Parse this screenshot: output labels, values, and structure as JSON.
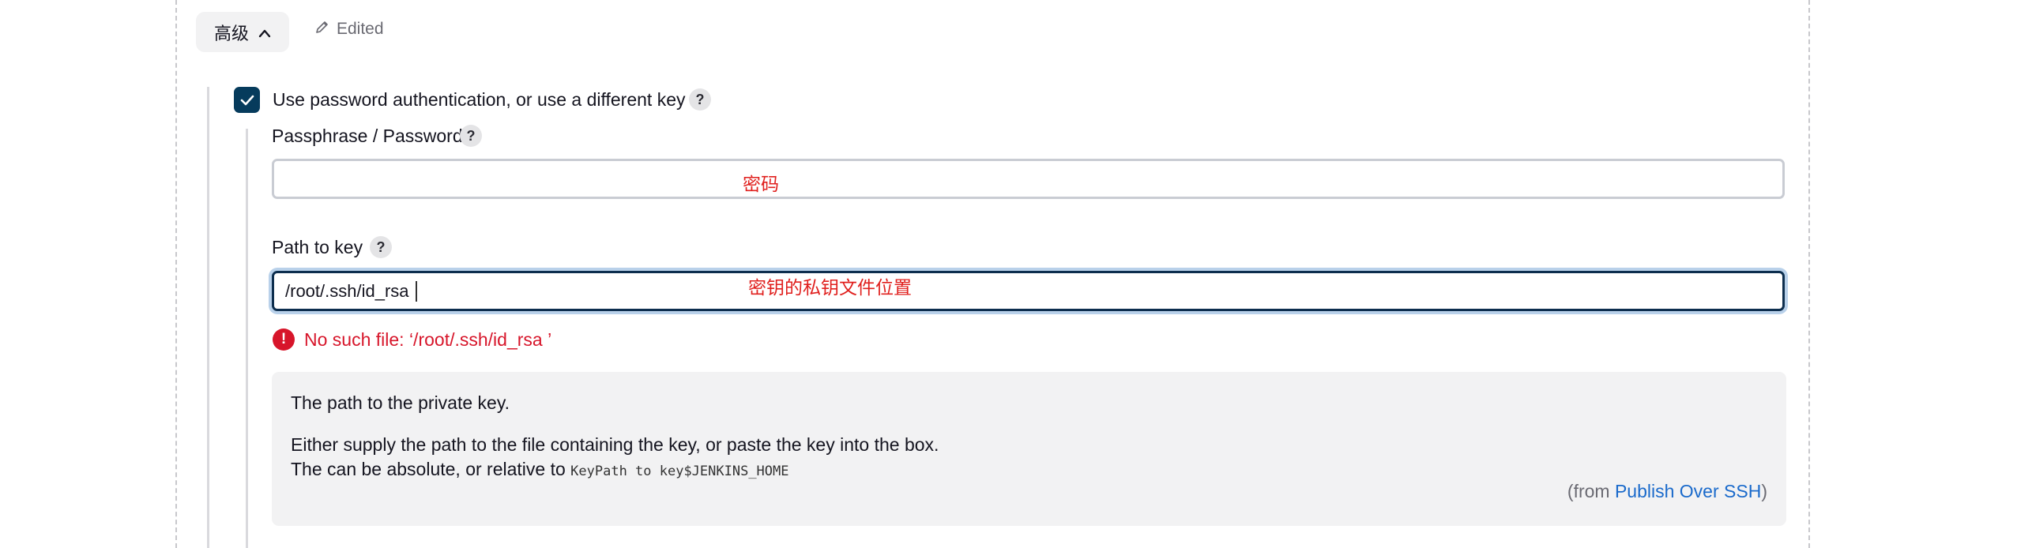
{
  "advanced": {
    "label": "高级",
    "chevron": "chevron-up-icon"
  },
  "edited": {
    "label": "Edited",
    "icon": "pencil-icon"
  },
  "password_auth": {
    "checked": true,
    "label": "Use password authentication, or use a different key",
    "help": "?"
  },
  "passphrase": {
    "label": "Passphrase / Password",
    "help": "?",
    "value": "",
    "annotation": "密码"
  },
  "path_to_key": {
    "label": "Path to key",
    "help": "?",
    "value": "/root/.ssh/id_rsa",
    "annotation": "密钥的私钥文件位置"
  },
  "error": {
    "icon": "!",
    "message": "No such file: ‘/root/.ssh/id_rsa ’"
  },
  "help_panel": {
    "line1": "The path to the private key.",
    "line2": "Either supply the path to the file containing the key, or paste the key into the box.",
    "line3_prefix": "The can be absolute, or relative to ",
    "line3_code": "KeyPath to key$JENKINS_HOME",
    "from_open": "(from ",
    "from_link": "Publish Over SSH",
    "from_close": ")"
  },
  "colors": {
    "accent": "#063b5c",
    "error": "#d7152a",
    "link": "#1a6acb",
    "annotation": "#e0201e"
  }
}
